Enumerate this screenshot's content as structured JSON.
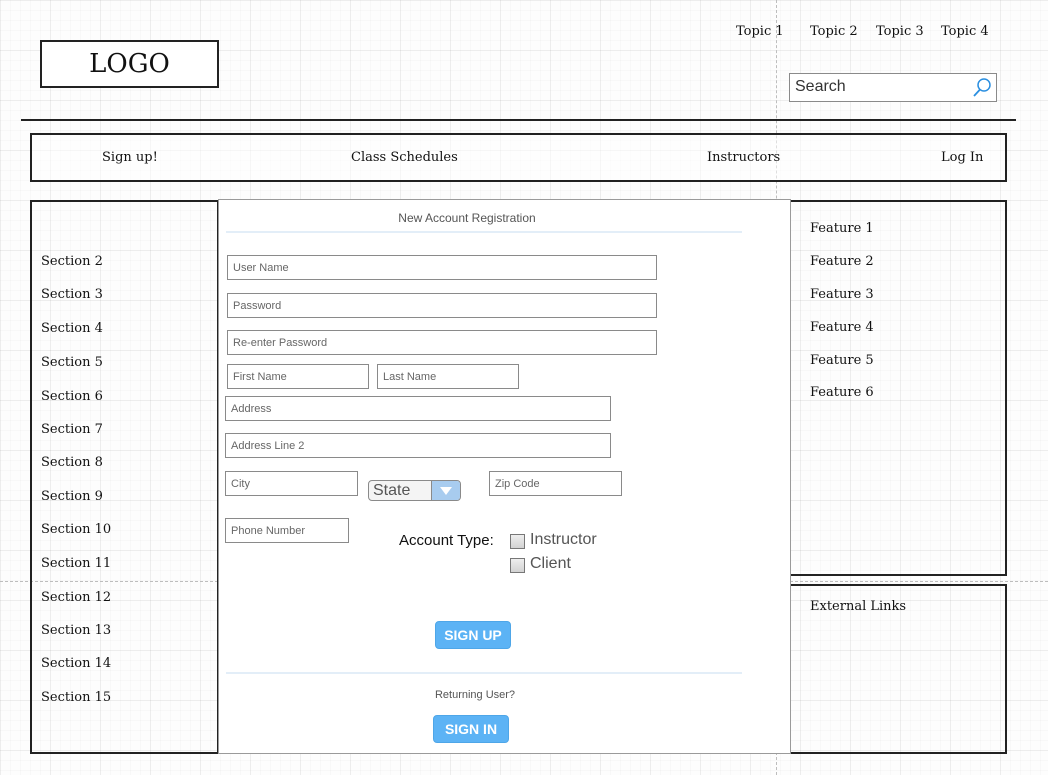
{
  "header": {
    "logo": "LOGO",
    "topics": [
      "Topic 1",
      "Topic 2",
      "Topic 3",
      "Topic 4"
    ],
    "search_placeholder": "Search"
  },
  "nav": {
    "signup": "Sign up!",
    "schedules": "Class Schedules",
    "instructors": "Instructors",
    "login": "Log In"
  },
  "sidebar": {
    "sections": [
      "Section 2",
      "Section 3",
      "Section 4",
      "Section 5",
      "Section 6",
      "Section 7",
      "Section 8",
      "Section 9",
      "Section 10",
      "Section 11",
      "Section 12",
      "Section 13",
      "Section 14",
      "Section 15"
    ]
  },
  "features": [
    "Feature 1",
    "Feature 2",
    "Feature 3",
    "Feature 4",
    "Feature 5",
    "Feature 6"
  ],
  "external_links": "External Links",
  "form": {
    "title": "New Account Registration",
    "username_placeholder": "User Name",
    "password_placeholder": "Password",
    "reenter_placeholder": "Re-enter Password",
    "firstname_placeholder": "First Name",
    "lastname_placeholder": "Last Name",
    "address_placeholder": "Address",
    "address2_placeholder": "Address Line 2",
    "city_placeholder": "City",
    "state_label": "State",
    "zip_placeholder": "Zip Code",
    "phone_placeholder": "Phone Number",
    "account_type_label": "Account Type:",
    "instructor_label": "Instructor",
    "client_label": "Client",
    "signup_button": "SIGN UP",
    "returning_label": "Returning User?",
    "signin_button": "SIGN IN"
  },
  "colors": {
    "accent": "#5cb3f5",
    "separator": "#e3eef8",
    "select_button": "#a8ccef"
  }
}
